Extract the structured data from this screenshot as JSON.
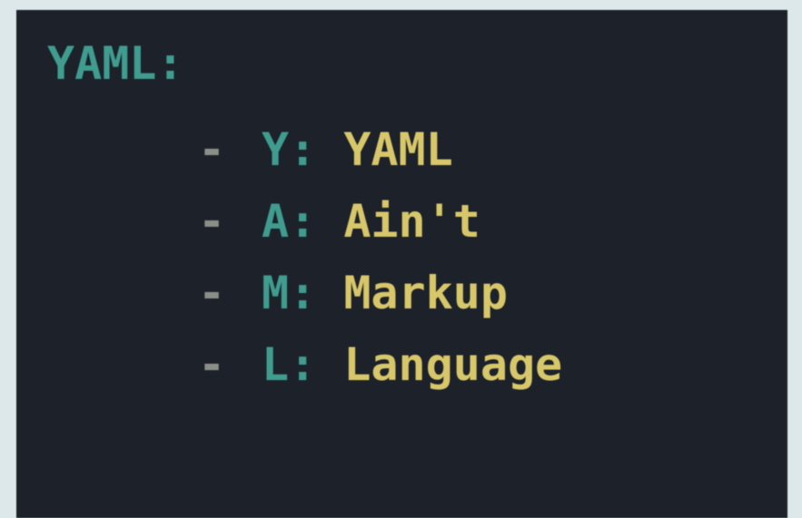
{
  "colors": {
    "background": "#dde8ea",
    "editor_background": "#1c212a",
    "key": "#3f9c8f",
    "value": "#d7c76a",
    "dash": "#8a8f87"
  },
  "code": {
    "root_key": "YAML",
    "root_colon": ":",
    "items": [
      {
        "dash": "-",
        "key": "Y",
        "colon": ":",
        "value": "YAML"
      },
      {
        "dash": "-",
        "key": "A",
        "colon": ":",
        "value": "Ain't"
      },
      {
        "dash": "-",
        "key": "M",
        "colon": ":",
        "value": "Markup"
      },
      {
        "dash": "-",
        "key": "L",
        "colon": ":",
        "value": "Language"
      }
    ]
  }
}
